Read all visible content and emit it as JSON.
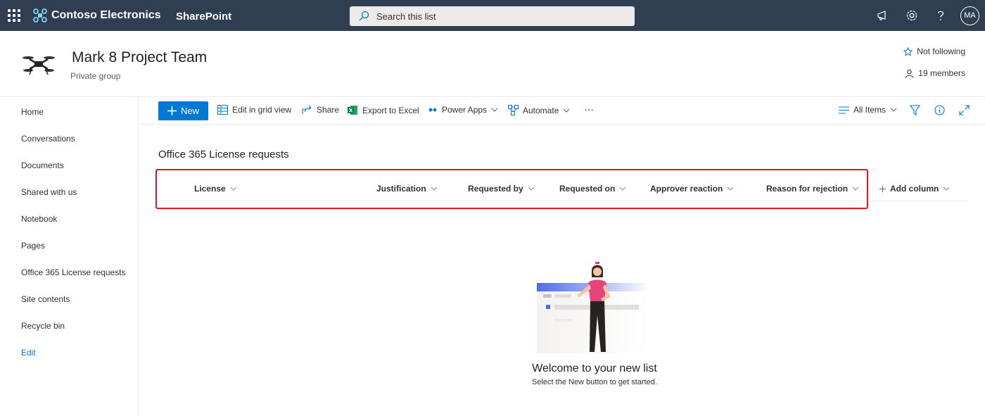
{
  "suitebar": {
    "brand": "Contoso Electronics",
    "app": "SharePoint",
    "search_placeholder": "Search this list",
    "avatar_initials": "MA"
  },
  "site": {
    "title": "Mark 8 Project Team",
    "subtitle": "Private group",
    "follow_label": "Not following",
    "members_label": "19 members"
  },
  "nav": {
    "items": [
      {
        "label": "Home"
      },
      {
        "label": "Conversations"
      },
      {
        "label": "Documents"
      },
      {
        "label": "Shared with us"
      },
      {
        "label": "Notebook"
      },
      {
        "label": "Pages"
      },
      {
        "label": "Office 365 License requests"
      },
      {
        "label": "Site contents"
      },
      {
        "label": "Recycle bin"
      }
    ],
    "edit_label": "Edit"
  },
  "commandbar": {
    "new_label": "New",
    "grid_label": "Edit in grid view",
    "share_label": "Share",
    "export_label": "Export to Excel",
    "powerapps_label": "Power Apps",
    "automate_label": "Automate",
    "more_label": "···",
    "view_label": "All Items"
  },
  "list": {
    "title": "Office 365 License requests",
    "columns": [
      "License",
      "Justification",
      "Requested by",
      "Requested on",
      "Approver reaction",
      "Reason for rejection"
    ],
    "add_column_label": "Add column"
  },
  "empty_state": {
    "title": "Welcome to your new list",
    "subtitle": "Select the New button to get started."
  },
  "colors": {
    "suitebar_bg": "#2f3e50",
    "accent": "#0078d4",
    "highlight": "#e81123"
  }
}
